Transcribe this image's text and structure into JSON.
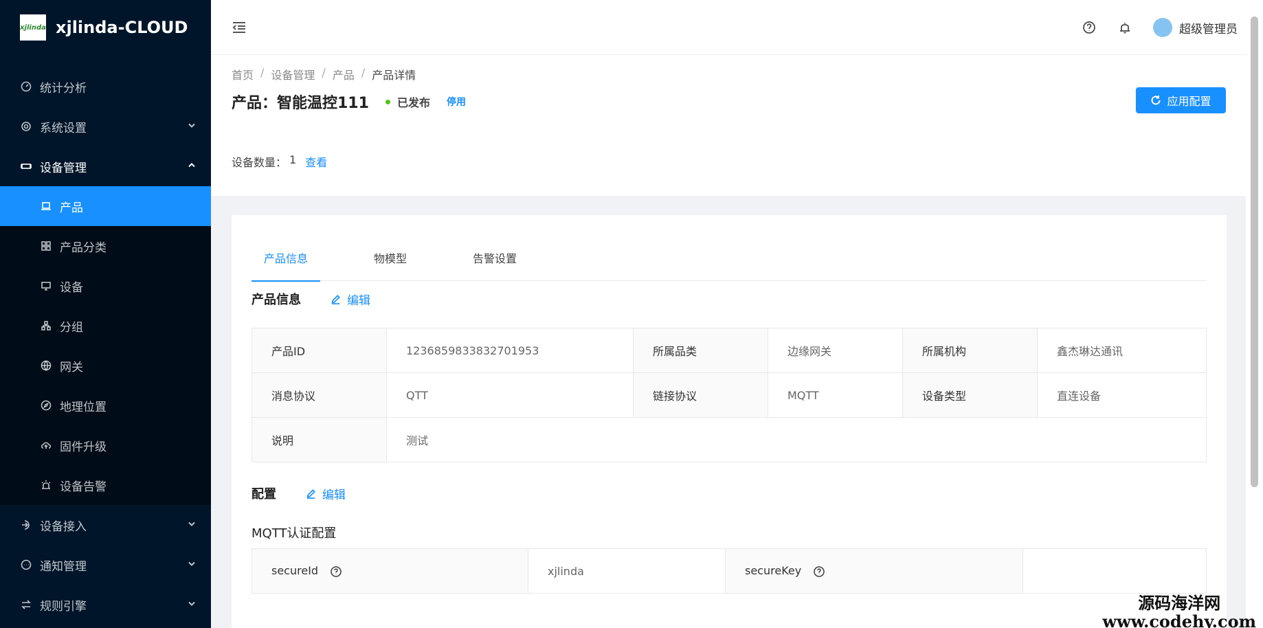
{
  "app": {
    "logo_text": "xjlinda",
    "name": "xjlinda-CLOUD"
  },
  "sidebar": {
    "items": [
      {
        "label": "统计分析"
      },
      {
        "label": "系统设置"
      },
      {
        "label": "设备管理"
      },
      {
        "label": "设备接入"
      },
      {
        "label": "通知管理"
      },
      {
        "label": "规则引擎"
      }
    ],
    "submenu": [
      {
        "label": "产品"
      },
      {
        "label": "产品分类"
      },
      {
        "label": "设备"
      },
      {
        "label": "分组"
      },
      {
        "label": "网关"
      },
      {
        "label": "地理位置"
      },
      {
        "label": "固件升级"
      },
      {
        "label": "设备告警"
      }
    ]
  },
  "header": {
    "username": "超级管理员"
  },
  "breadcrumb": [
    "首页",
    "设备管理",
    "产品",
    "产品详情"
  ],
  "page": {
    "title": "产品：智能温控111",
    "status": "已发布",
    "disable_label": "停用",
    "apply_label": "应用配置",
    "device_count_label": "设备数量：",
    "device_count": "1",
    "view_label": "查看"
  },
  "tabs": [
    "产品信息",
    "物模型",
    "告警设置"
  ],
  "product_info": {
    "section_title": "产品信息",
    "edit_label": "编辑",
    "rows": [
      [
        {
          "label": "产品ID",
          "value": "1236859833832701953"
        },
        {
          "label": "所属品类",
          "value": "边缘网关"
        },
        {
          "label": "所属机构",
          "value": "鑫杰琳达通讯"
        }
      ],
      [
        {
          "label": "消息协议",
          "value": "QTT"
        },
        {
          "label": "链接协议",
          "value": "MQTT"
        },
        {
          "label": "设备类型",
          "value": "直连设备"
        }
      ]
    ],
    "desc_label": "说明",
    "desc_value": "测试"
  },
  "config": {
    "section_title": "配置",
    "edit_label": "编辑",
    "mqtt_title": "MQTT认证配置",
    "secure_id_label": "secureId",
    "secure_id_value": "xjlinda",
    "secure_key_label": "secureKey",
    "secure_key_value": ""
  },
  "watermark": {
    "line1": "源码海洋网",
    "line2": "www.codehy.com"
  }
}
